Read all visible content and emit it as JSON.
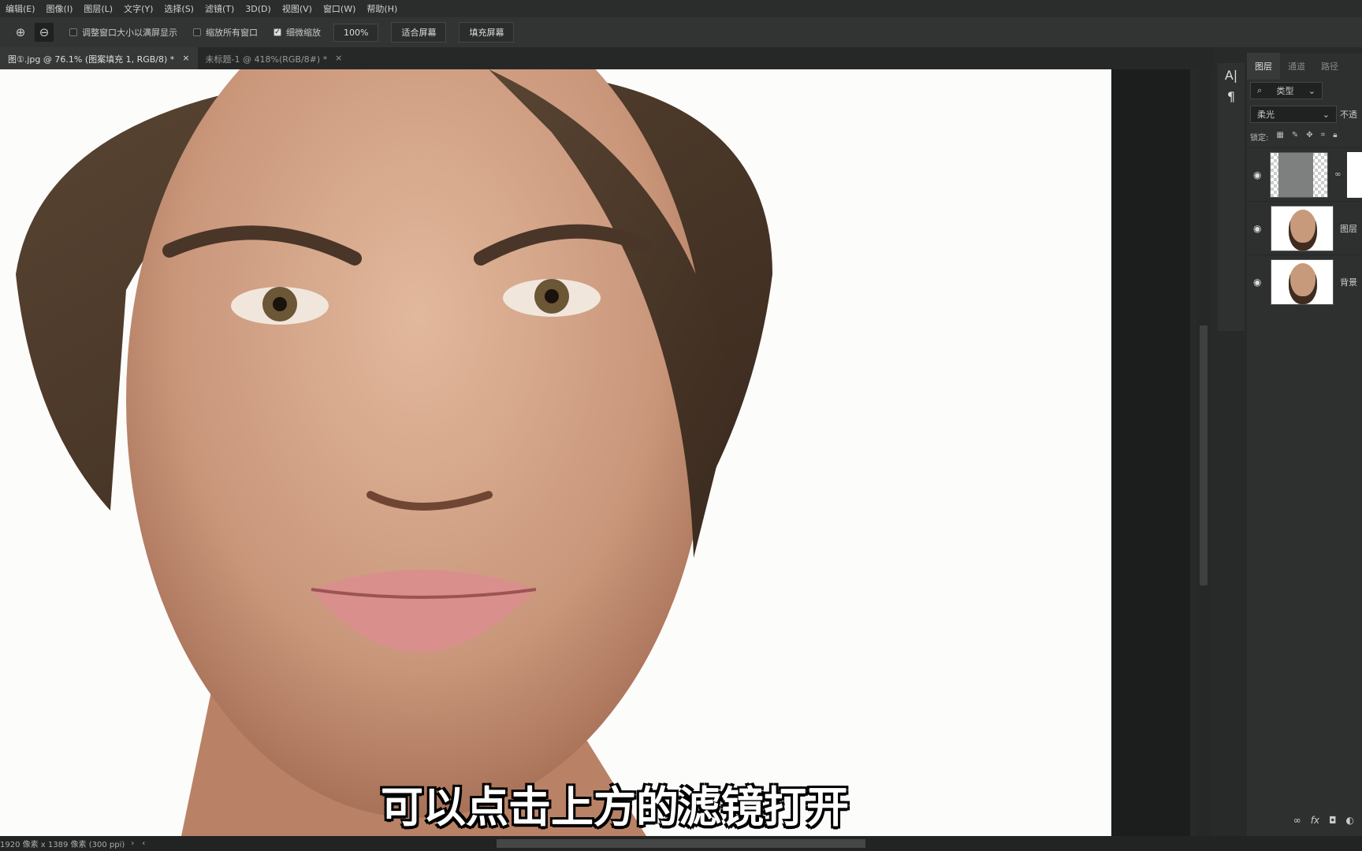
{
  "menu": [
    "编辑(E)",
    "图像(I)",
    "图层(L)",
    "文字(Y)",
    "选择(S)",
    "滤镜(T)",
    "3D(D)",
    "视图(V)",
    "窗口(W)",
    "帮助(H)"
  ],
  "options": {
    "zoom_in_icon": "zoom-in",
    "zoom_out_icon": "zoom-out",
    "resize_windows": "调整窗口大小以满屏显示",
    "zoom_all": "缩放所有窗口",
    "scrubby_zoom": "细微缩放",
    "scrubby_checked": true,
    "zoom_level": "100%",
    "fit_screen": "适合屏幕",
    "fill_screen": "填充屏幕"
  },
  "tabs": [
    {
      "label": "图①.jpg @ 76.1% (图案填充 1, RGB/8) *",
      "active": true
    },
    {
      "label": "未标题-1 @ 418%(RGB/8#) *",
      "active": false
    }
  ],
  "panel": {
    "tabs": [
      "图层",
      "通道",
      "路径"
    ],
    "filter": "类型",
    "blend_mode": "柔光",
    "opacity_label": "不透",
    "lock_label": "锁定:",
    "layers": [
      {
        "name": "",
        "type": "pattern-fill"
      },
      {
        "name": "图层",
        "type": "photo"
      },
      {
        "name": "背景",
        "type": "photo"
      }
    ]
  },
  "status": {
    "doc_info": "1920 像素 x 1389 像素 (300 ppi)"
  },
  "subtitle": "可以点击上方的滤镜打开"
}
